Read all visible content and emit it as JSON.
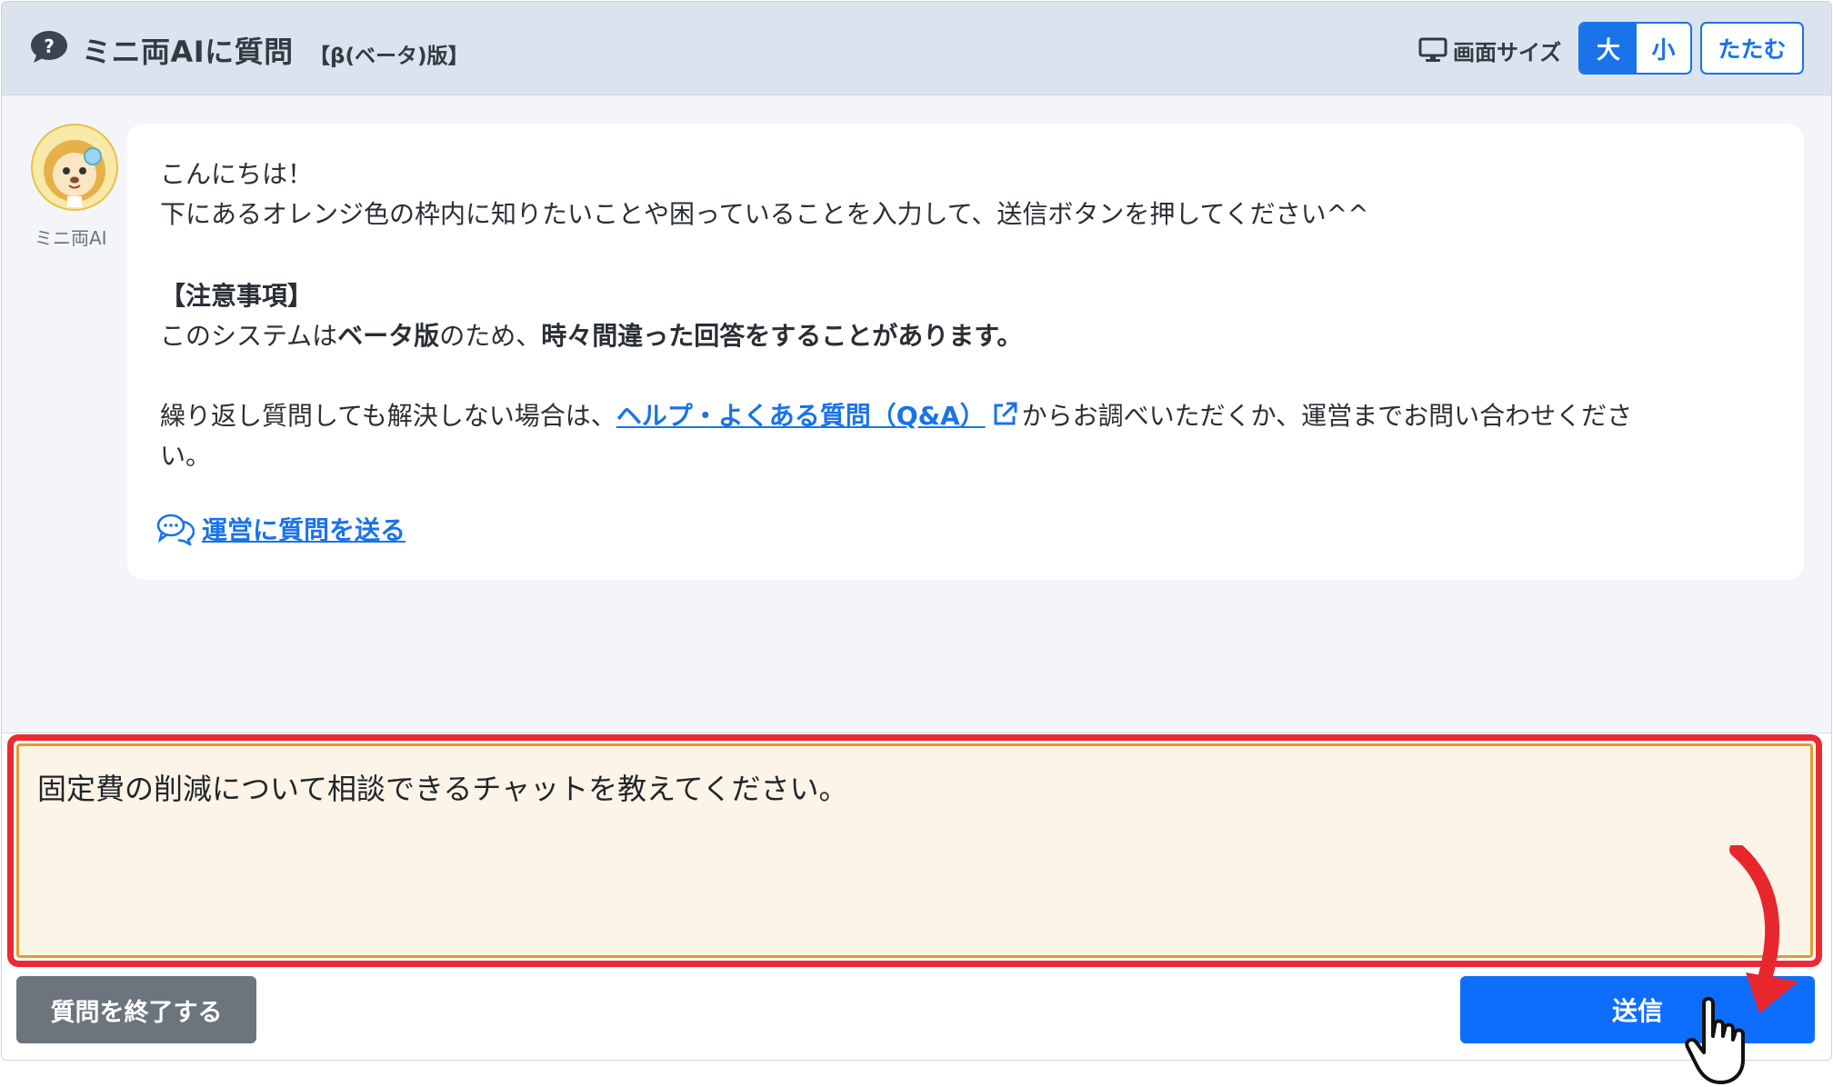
{
  "header": {
    "title": "ミニ両AIに質問",
    "beta_label": "【β(ベータ)版】",
    "screen_size_label": "画面サイズ",
    "size_large": "大",
    "size_small": "小",
    "collapse_label": "たたむ"
  },
  "bot": {
    "name": "ミニ両AI"
  },
  "message": {
    "greeting": "こんにちは！",
    "instruction": "下にあるオレンジ色の枠内に知りたいことや困っていることを入力して、送信ボタンを押してください^^",
    "notice_heading": "【注意事項】",
    "notice_prefix": "このシステムは",
    "notice_bold1": "ベータ版",
    "notice_middle": "のため、",
    "notice_bold2": "時々間違った回答をすることがあります。",
    "help_prefix": "繰り返し質問しても解決しない場合は、",
    "help_link": "ヘルプ・よくある質問（Q&A）",
    "help_suffix": "からお調べいただくか、運営までお問い合わせくださ",
    "help_suffix_wrap": "い。",
    "contact_link": "運営に質問を送る"
  },
  "input": {
    "value": "固定費の削減について相談できるチャットを教えてください。"
  },
  "footer": {
    "end_button": "質問を終了する",
    "send_button": "送信"
  }
}
